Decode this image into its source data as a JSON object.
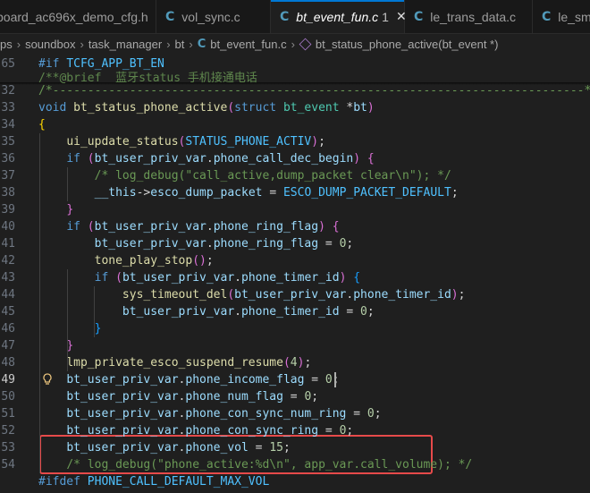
{
  "tabs": [
    {
      "label": "board_ac696x_demo_cfg.h",
      "icon": "header-file-icon",
      "active": false
    },
    {
      "label": "vol_sync.c",
      "icon": "c-file-icon",
      "active": false
    },
    {
      "label": "bt_event_fun.c",
      "icon": "c-file-icon",
      "active": true,
      "dirty_count": "1"
    },
    {
      "label": "le_trans_data.c",
      "icon": "c-file-icon",
      "active": false
    },
    {
      "label": "le_sma",
      "icon": "c-file-icon",
      "active": false
    }
  ],
  "breadcrumb": {
    "items": [
      "ps",
      "soundbox",
      "task_manager",
      "bt"
    ],
    "file": "bt_event_fun.c",
    "symbol": "bt_status_phone_active(bt_event *)"
  },
  "lines": [
    {
      "num": "65",
      "text": "#if TCFG_APP_BT_EN"
    },
    {
      "num": "",
      "text": "/**@brief  蓝牙status 手机接通电话"
    },
    {
      "num": "32",
      "text": "/*----------------------------------------------------------------------------*/"
    },
    {
      "num": "33",
      "text": "void bt_status_phone_active(struct bt_event *bt)"
    },
    {
      "num": "34",
      "text": "{"
    },
    {
      "num": "35",
      "text": "    ui_update_status(STATUS_PHONE_ACTIV);"
    },
    {
      "num": "36",
      "text": "    if (bt_user_priv_var.phone_call_dec_begin) {"
    },
    {
      "num": "37",
      "text": "        /* log_debug(\"call_active,dump_packet clear\\n\"); */"
    },
    {
      "num": "38",
      "text": "        __this->esco_dump_packet = ESCO_DUMP_PACKET_DEFAULT;"
    },
    {
      "num": "39",
      "text": "    }"
    },
    {
      "num": "40",
      "text": "    if (bt_user_priv_var.phone_ring_flag) {"
    },
    {
      "num": "41",
      "text": "        bt_user_priv_var.phone_ring_flag = 0;"
    },
    {
      "num": "42",
      "text": "        tone_play_stop();"
    },
    {
      "num": "43",
      "text": "        if (bt_user_priv_var.phone_timer_id) {"
    },
    {
      "num": "44",
      "text": "            sys_timeout_del(bt_user_priv_var.phone_timer_id);"
    },
    {
      "num": "45",
      "text": "            bt_user_priv_var.phone_timer_id = 0;"
    },
    {
      "num": "46",
      "text": "        }"
    },
    {
      "num": "47",
      "text": "    }"
    },
    {
      "num": "48",
      "text": "    lmp_private_esco_suspend_resume(4);"
    },
    {
      "num": "49",
      "text": "    bt_user_priv_var.phone_income_flag = 0;"
    },
    {
      "num": "50",
      "text": "    bt_user_priv_var.phone_num_flag = 0;"
    },
    {
      "num": "51",
      "text": "    bt_user_priv_var.phone_con_sync_num_ring = 0;"
    },
    {
      "num": "52",
      "text": "    bt_user_priv_var.phone_con_sync_ring = 0;"
    },
    {
      "num": "53",
      "text": "    bt_user_priv_var.phone_vol = 15;"
    },
    {
      "num": "54",
      "text": "    /* log_debug(\"phone_active:%d\\n\", app_var.call_volume); */"
    },
    {
      "num": "",
      "text": "#ifdef PHONE_CALL_DEFAULT_MAX_VOL"
    }
  ],
  "colors": {
    "accent": "#0078d4",
    "highlight_box": "#e64a4a",
    "lightbulb": "#e5c07b"
  }
}
